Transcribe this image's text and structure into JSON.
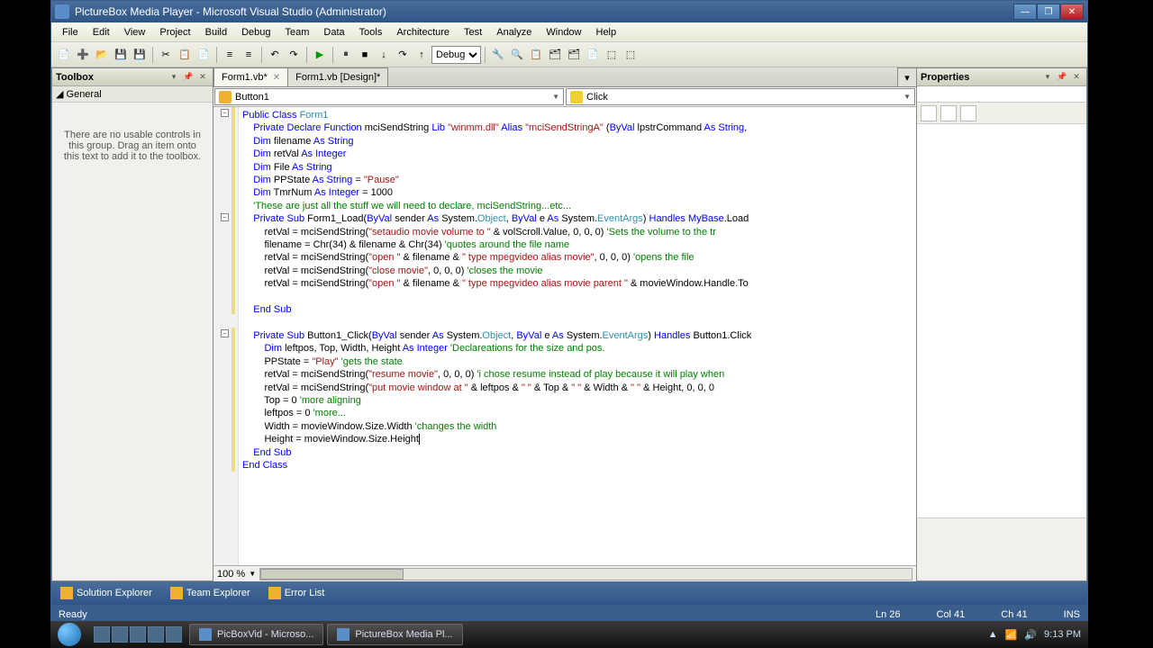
{
  "window": {
    "title": "PictureBox Media Player - Microsoft Visual Studio (Administrator)"
  },
  "menu": {
    "items": [
      "File",
      "Edit",
      "View",
      "Project",
      "Build",
      "Debug",
      "Team",
      "Data",
      "Tools",
      "Architecture",
      "Test",
      "Analyze",
      "Window",
      "Help"
    ]
  },
  "toolbar": {
    "config": "Debug"
  },
  "toolbox": {
    "title": "Toolbox",
    "category": "General",
    "empty": "There are no usable controls in this group. Drag an item onto this text to add it to the toolbox."
  },
  "tabs": {
    "items": [
      {
        "label": "Form1.vb*",
        "active": true,
        "close": true
      },
      {
        "label": "Form1.vb [Design]*",
        "active": false,
        "close": false
      }
    ]
  },
  "combos": {
    "object": "Button1",
    "event": "Click"
  },
  "zoom": "100 %",
  "properties": {
    "title": "Properties"
  },
  "bottom_tabs": [
    "Solution Explorer",
    "Team Explorer",
    "Error List"
  ],
  "status": {
    "state": "Ready",
    "ln": "Ln 26",
    "col": "Col 41",
    "ch": "Ch 41",
    "ins": "INS"
  },
  "taskbar": {
    "items": [
      "PicBoxVid - Microso...",
      "PictureBox Media Pl..."
    ],
    "time": "9:13 PM"
  },
  "code": {
    "l1": {
      "a": "Public Class ",
      "b": "Form1"
    },
    "l2": {
      "a": "Private Declare Function ",
      "b": "mciSendString ",
      "c": "Lib ",
      "d": "\"winmm.dll\" ",
      "e": "Alias ",
      "f": "\"mciSendStringA\" ",
      "g": "(",
      "h": "ByVal ",
      "i": "lpstrCommand ",
      "j": "As String",
      ",k": ","
    },
    "l3": {
      "a": "Dim ",
      "b": "filename ",
      "c": "As String"
    },
    "l4": {
      "a": "Dim ",
      "b": "retVal ",
      "c": "As Integer"
    },
    "l5": {
      "a": "Dim ",
      "b": "File ",
      "c": "As String"
    },
    "l6": {
      "a": "Dim ",
      "b": "PPState ",
      "c": "As String ",
      "d": "= ",
      "e": "\"Pause\""
    },
    "l7": {
      "a": "Dim ",
      "b": "TmrNum ",
      "c": "As Integer ",
      "d": "= 1000"
    },
    "l8": "'These are just all the stuff we will need to declare, mciSendString...etc...",
    "l9": {
      "a": "Private Sub ",
      "b": "Form1_Load(",
      "c": "ByVal ",
      "d": "sender ",
      "e": "As ",
      "f": "System.",
      "g": "Object",
      "h": ", ",
      "i": "ByVal ",
      "j": "e ",
      "k": "As ",
      "l": "System.",
      "m": "EventArgs",
      "n": ") ",
      "o": "Handles MyBase",
      "p": ".Load"
    },
    "l10": {
      "a": "retVal = mciSendString(",
      "b": "\"setaudio movie volume to \"",
      "c": " & volScroll.Value, 0, 0, 0) ",
      "d": "'Sets the volume to the tr"
    },
    "l11": {
      "a": "filename = Chr(34) & filename & Chr(34) ",
      "b": "'quotes around the file name"
    },
    "l12": {
      "a": "retVal = mciSendString(",
      "b": "\"open \"",
      "c": " & filename & ",
      "d": "\" type mpegvideo alias movie\"",
      "e": ", 0, 0, 0) ",
      "f": "'opens the file"
    },
    "l13": {
      "a": "retVal = mciSendString(",
      "b": "\"close movie\"",
      "c": ", 0, 0, 0) ",
      "d": "'closes the movie"
    },
    "l14": {
      "a": "retVal = mciSendString(",
      "b": "\"open \"",
      "c": " & filename & ",
      "d": "\" type mpegvideo alias movie parent \"",
      "e": " & movieWindow.Handle.To"
    },
    "l15": "End Sub",
    "l16": {
      "a": "Private Sub ",
      "b": "Button1_Click(",
      "c": "ByVal ",
      "d": "sender ",
      "e": "As ",
      "f": "System.",
      "g": "Object",
      "h": ", ",
      "i": "ByVal ",
      "j": "e ",
      "k": "As ",
      "l": "System.",
      "m": "EventArgs",
      "n": ") ",
      "o": "Handles ",
      "p": "Button1.Click"
    },
    "l17": {
      "a": "Dim ",
      "b": "leftpos, Top, Width, Height ",
      "c": "As Integer ",
      "d": "'Declareations for the size and pos."
    },
    "l18": {
      "a": "PPState = ",
      "b": "\"Play\" ",
      "c": "'gets the state"
    },
    "l19": {
      "a": "retVal = mciSendString(",
      "b": "\"resume movie\"",
      "c": ", 0, 0, 0) ",
      "d": "'i chose resume instead of play because it will play when"
    },
    "l20": {
      "a": "retVal = mciSendString(",
      "b": "\"put movie window at \"",
      "c": " & leftpos & ",
      "d": "\" \"",
      "e": " & Top & ",
      "f": "\" \"",
      "g": " & Width & ",
      "h": "\" \"",
      "i": " & Height, 0, 0, 0"
    },
    "l21": {
      "a": "Top = 0 ",
      "b": "'more aligning"
    },
    "l22": {
      "a": "leftpos = 0 ",
      "b": "'more..."
    },
    "l23": {
      "a": "Width = movieWindow.Size.Width ",
      "b": "'changes the width"
    },
    "l24": "Height = movieWindow.Size.Height",
    "l25": "End Sub",
    "l26": "End Class"
  }
}
